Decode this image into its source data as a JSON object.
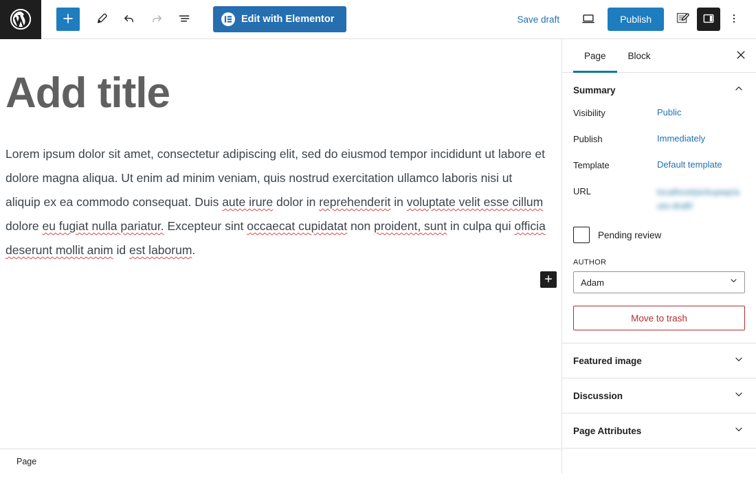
{
  "toolbar": {
    "logo_icon": "wordpress-logo-icon",
    "add_block_label": "+",
    "add_block_icon": "plus-icon",
    "tools_icon": "pencil-icon",
    "undo_icon": "undo-arrow-icon",
    "redo_icon": "redo-arrow-icon",
    "list_view_icon": "list-view-icon",
    "elementor_label": "Edit with Elementor",
    "elementor_icon": "elementor-logo-icon",
    "save_draft_label": "Save draft",
    "preview_icon": "desktop-preview-icon",
    "publish_label": "Publish",
    "editor_mode_icon": "edit-pencil-square-icon",
    "settings_sidebar_icon": "sidebar-panel-icon",
    "options_icon": "three-dots-vertical-icon"
  },
  "canvas": {
    "title_placeholder": "Add title",
    "paragraph": {
      "clean_prefix": "Lorem ipsum dolor sit amet, consectetur adipiscing elit, sed do eiusmod tempor incididunt ut labore et dolore magna aliqua. Ut enim ad minim veniam, quis nostrud exercitation ullamco laboris nisi ut aliquip ex ea commodo consequat. Duis ",
      "spell_1": "aute irure",
      "mid_1": " dolor in ",
      "spell_2": "reprehenderit",
      "mid_2": " in ",
      "spell_3": "voluptate velit esse cillum",
      "mid_3": " dolore ",
      "spell_4": "eu fugiat nulla pariatur.",
      "mid_4": " Excepteur sint ",
      "spell_5": "occaecat cupidatat",
      "mid_5": " non ",
      "spell_6": "proident, sunt",
      "mid_6": " in culpa qui ",
      "spell_7": "officia deserunt mollit anim",
      "mid_7": " id ",
      "spell_8": "est laborum",
      "tail": "."
    },
    "insert_block_icon": "plus-icon"
  },
  "sidebar": {
    "tabs": [
      {
        "label": "Page",
        "active": true
      },
      {
        "label": "Block",
        "active": false
      }
    ],
    "close_icon": "close-x-icon",
    "summary": {
      "title": "Summary",
      "chevron_icon": "chevron-up-icon",
      "rows": [
        {
          "label": "Visibility",
          "value": "Public",
          "blurred": false
        },
        {
          "label": "Publish",
          "value": "Immediately",
          "blurred": false
        },
        {
          "label": "Template",
          "value": "Default template",
          "blurred": false
        },
        {
          "label": "URL",
          "value": "localhost/pickupwp/auto-draft/",
          "blurred": true
        }
      ],
      "pending_review_label": "Pending review",
      "pending_review_checked": false,
      "author_field_label": "AUTHOR",
      "author_value": "Adam",
      "author_chevron_icon": "chevron-down-icon",
      "trash_label": "Move to trash"
    },
    "panels": [
      {
        "title": "Featured image",
        "chevron_icon": "chevron-down-icon"
      },
      {
        "title": "Discussion",
        "chevron_icon": "chevron-down-icon"
      },
      {
        "title": "Page Attributes",
        "chevron_icon": "chevron-down-icon"
      }
    ]
  },
  "statusbar": {
    "label": "Page"
  },
  "colors": {
    "accent_blue": "#1d7dbe",
    "link_blue": "#2271b1",
    "tab_underline": "#0b7a9e",
    "dark": "#1e1e1e",
    "danger_red": "#b32d2e",
    "spellcheck_red": "#e04545"
  }
}
